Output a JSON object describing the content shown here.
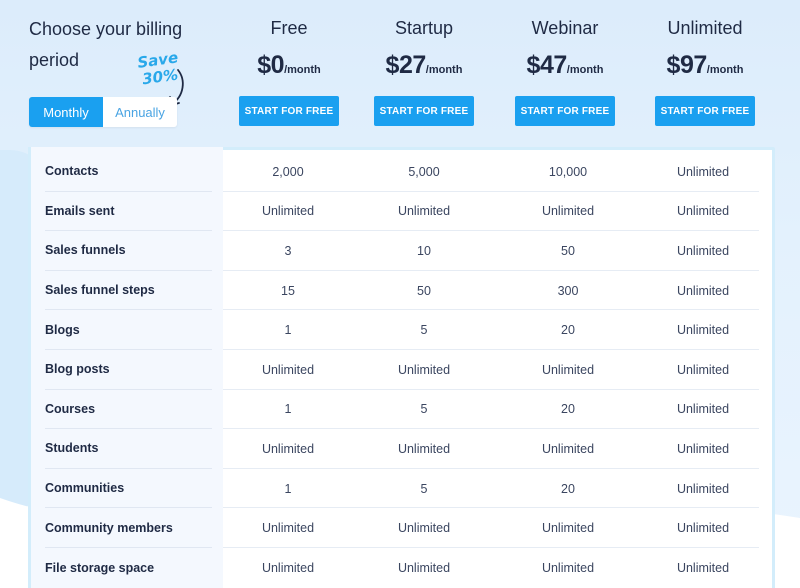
{
  "billing": {
    "title": "Choose your billing period",
    "save_note_line1": "Save",
    "save_note_line2": "30%",
    "toggle": {
      "monthly": "Monthly",
      "annually": "Annually",
      "selected": "Monthly"
    }
  },
  "plans": [
    {
      "name": "Free",
      "price": "$0",
      "period": "/month",
      "cta": "START FOR FREE"
    },
    {
      "name": "Startup",
      "price": "$27",
      "period": "/month",
      "cta": "START FOR FREE"
    },
    {
      "name": "Webinar",
      "price": "$47",
      "period": "/month",
      "cta": "START FOR FREE"
    },
    {
      "name": "Unlimited",
      "price": "$97",
      "period": "/month",
      "cta": "START FOR FREE"
    }
  ],
  "features": [
    {
      "label": "Contacts",
      "values": [
        "2,000",
        "5,000",
        "10,000",
        "Unlimited"
      ]
    },
    {
      "label": "Emails sent",
      "values": [
        "Unlimited",
        "Unlimited",
        "Unlimited",
        "Unlimited"
      ]
    },
    {
      "label": "Sales funnels",
      "values": [
        "3",
        "10",
        "50",
        "Unlimited"
      ]
    },
    {
      "label": "Sales funnel steps",
      "values": [
        "15",
        "50",
        "300",
        "Unlimited"
      ]
    },
    {
      "label": "Blogs",
      "values": [
        "1",
        "5",
        "20",
        "Unlimited"
      ]
    },
    {
      "label": "Blog posts",
      "values": [
        "Unlimited",
        "Unlimited",
        "Unlimited",
        "Unlimited"
      ]
    },
    {
      "label": "Courses",
      "values": [
        "1",
        "5",
        "20",
        "Unlimited"
      ]
    },
    {
      "label": "Students",
      "values": [
        "Unlimited",
        "Unlimited",
        "Unlimited",
        "Unlimited"
      ]
    },
    {
      "label": "Communities",
      "values": [
        "1",
        "5",
        "20",
        "Unlimited"
      ]
    },
    {
      "label": "Community members",
      "values": [
        "Unlimited",
        "Unlimited",
        "Unlimited",
        "Unlimited"
      ]
    },
    {
      "label": "File storage space",
      "values": [
        "Unlimited",
        "Unlimited",
        "Unlimited",
        "Unlimited"
      ]
    }
  ],
  "colors": {
    "accent": "#1aa0f0",
    "text": "#1f2a44",
    "save_note": "#29a8ea"
  }
}
